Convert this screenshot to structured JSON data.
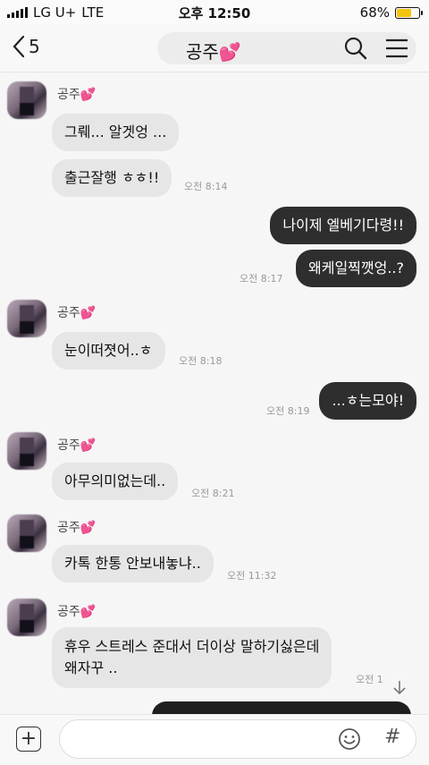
{
  "status_bar": {
    "carrier": "LG U+",
    "network": "LTE",
    "time": "오후 12:50",
    "battery": "68%",
    "battery_level": 0.68
  },
  "header": {
    "back_count": "5",
    "title": "공주💕"
  },
  "messages": [
    {
      "side": "in",
      "sender": "공주💕",
      "text": "그뤠... 알겟엉 ...",
      "time": ""
    },
    {
      "side": "in",
      "sender": "",
      "text": "출근잘행 ㅎㅎ!!",
      "time": "오전 8:14"
    },
    {
      "side": "out",
      "text": "나이제 엘베기다령!!",
      "time": ""
    },
    {
      "side": "out",
      "text": "왜케일찍깻엉..?",
      "time": "오전 8:17"
    },
    {
      "side": "in",
      "sender": "공주💕",
      "text": "눈이떠졋어..ㅎ",
      "time": "오전 8:18"
    },
    {
      "side": "out",
      "text": "...ㅎ는모야!",
      "time": "오전 8:19"
    },
    {
      "side": "in",
      "sender": "공주💕",
      "text": "아무의미없는데..",
      "time": "오전 8:21"
    },
    {
      "side": "in",
      "sender": "공주💕",
      "text": "카톡 한통 안보내놓냐..",
      "time": "오전 11:32"
    },
    {
      "side": "in",
      "sender": "공주💕",
      "text_line1": "휴우 스트레스 준대서 더이상 말하기싫은데",
      "text_line2": "왜자꾸 ..",
      "time": "오전 1"
    }
  ],
  "input": {
    "placeholder": ""
  },
  "colors": {
    "incoming_bubble": "#e6e6e6",
    "outgoing_bubble": "#2e2e2e",
    "battery": "#f3c310"
  }
}
